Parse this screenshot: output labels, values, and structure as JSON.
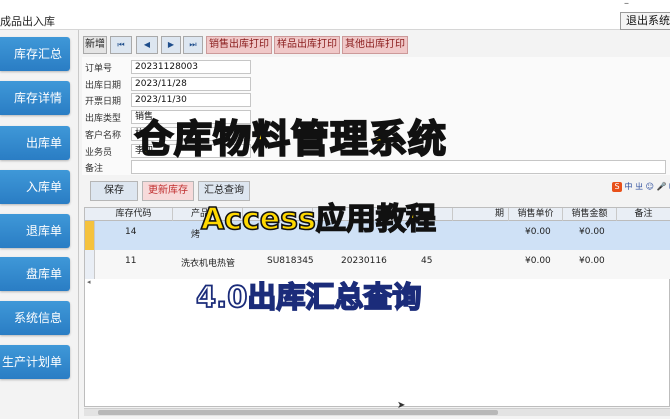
{
  "window": {
    "title": "成品出入库",
    "exit_label": "退出系统",
    "minimize_glyph": "–"
  },
  "sidebar": {
    "items": [
      {
        "label": "库存汇总"
      },
      {
        "label": "库存详情"
      },
      {
        "label": "出库单"
      },
      {
        "label": "入库单"
      },
      {
        "label": "退库单"
      },
      {
        "label": "盘库单"
      },
      {
        "label": "系统信息"
      },
      {
        "label": "生产计划单"
      }
    ]
  },
  "toolbar": {
    "new_label": "新增",
    "first_glyph": "⏮",
    "prev_glyph": "◀",
    "next_glyph": "▶",
    "last_glyph": "⏭",
    "print_sales_label": "销售出库打印",
    "print_sample_label": "样品出库打印",
    "print_other_label": "其他出库打印"
  },
  "form": {
    "order_no": {
      "label": "订单号",
      "value": "20231128003"
    },
    "out_date": {
      "label": "出库日期",
      "value": "2023/11/28"
    },
    "invoice_date": {
      "label": "开票日期",
      "value": "2023/11/30"
    },
    "out_type": {
      "label": "出库类型",
      "value": "销售"
    },
    "customer": {
      "label": "客户名称",
      "value": "杭"
    },
    "salesman": {
      "label": "业务员",
      "value": "李四"
    },
    "remark": {
      "label": "备注",
      "value": ""
    }
  },
  "actions": {
    "save_label": "保存",
    "refresh_label": "更新库存",
    "summary_label": "汇总查询"
  },
  "ime": {
    "logo": "S",
    "text": "中 ㄓ ☺ 🎤 ⌨"
  },
  "grid": {
    "columns": [
      {
        "label": "库存代码"
      },
      {
        "label": "产品"
      },
      {
        "label": ""
      },
      {
        "label": ""
      },
      {
        "label": ""
      },
      {
        "label": "期"
      },
      {
        "label": "销售单价"
      },
      {
        "label": "销售金额"
      },
      {
        "label": "备注"
      }
    ],
    "rows": [
      {
        "code": "14",
        "product": "烤",
        "model": "",
        "batch": "",
        "qty": "",
        "price": "¥0.00",
        "amount": "¥0.00",
        "remark": ""
      },
      {
        "code": "11",
        "product": "洗衣机电热管",
        "model": "SU818345",
        "batch": "20230116",
        "qty": "45",
        "price": "¥0.00",
        "amount": "¥0.00",
        "remark": ""
      }
    ]
  },
  "overlay": {
    "title": "仓库物料管理系统",
    "subtitle": "Access应用教程",
    "version": "4.0出库汇总查询"
  },
  "colors": {
    "nav_blue": "#2f86cc",
    "print_red": "#f0c8c8",
    "overlay_yellow": "#ffd800",
    "grid_active": "#cfe1f6"
  }
}
